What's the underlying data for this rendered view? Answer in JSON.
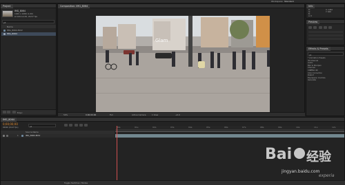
{
  "app": {
    "title": "Adobe After Effects CC",
    "menu": [
      "File",
      "Edit",
      "Composition",
      "Layer",
      "Effect",
      "Animation",
      "View",
      "Window",
      "Help"
    ],
    "workspace_label": "Workspace:",
    "workspace_value": "Standard"
  },
  "project_panel": {
    "tab": "Project",
    "selected_item": "IMG_8064",
    "item_info_1": "1920 x 1080 (1.00)",
    "item_info_2": "Δ 0;00;12;29, 29.97 fps",
    "search_placeholder": "ρ▾",
    "column_name": "Name",
    "items": [
      "IMG_8064.MOV",
      "IMG_8064"
    ],
    "bpc": "8 bpc"
  },
  "viewer": {
    "tab": "Composition: IMG_8064",
    "zoom": "50%",
    "timecode": "0;00;00;00",
    "resolution": "Full",
    "camera": "Active Camera",
    "views": "1 View",
    "offset": "+0.0"
  },
  "right_panels": {
    "info_tab": "Info",
    "info_lines": [
      "R:",
      "G:",
      "B:",
      "A: 0",
      "X: 1452",
      "Y: 600"
    ],
    "preview_tab": "Preview",
    "effects_tab": "Effects & Presets",
    "effects_search_placeholder": "ρ▾",
    "effects_items": [
      "* Animation Presets",
      "3D Channel",
      "Audio",
      "Blur & Sharpen",
      "Channel",
      "CINEMA 4D",
      "Color Correction",
      "Distort",
      "Expression Controls",
      "Generate"
    ]
  },
  "timeline": {
    "tab": "IMG_8064",
    "timecode": "0;00;00;00",
    "frame_info": "00000 (29.97 fps)",
    "search_placeholder": "ρ▾",
    "layer_header": "Source Name",
    "layer_index": "1",
    "layer_name": "IMG_8064.MOV",
    "ruler_ticks": [
      "00s",
      "01s",
      "02s",
      "03s",
      "04s",
      "05s",
      "06s",
      "07s",
      "08s",
      "09s",
      "10s",
      "11s",
      "12s"
    ],
    "toggle_label": "Toggle Switches / Modes"
  },
  "watermark": {
    "brand": "Bai",
    "brand_suffix": "经验",
    "url": "jingyan.baidu.com",
    "corner": "experia"
  }
}
